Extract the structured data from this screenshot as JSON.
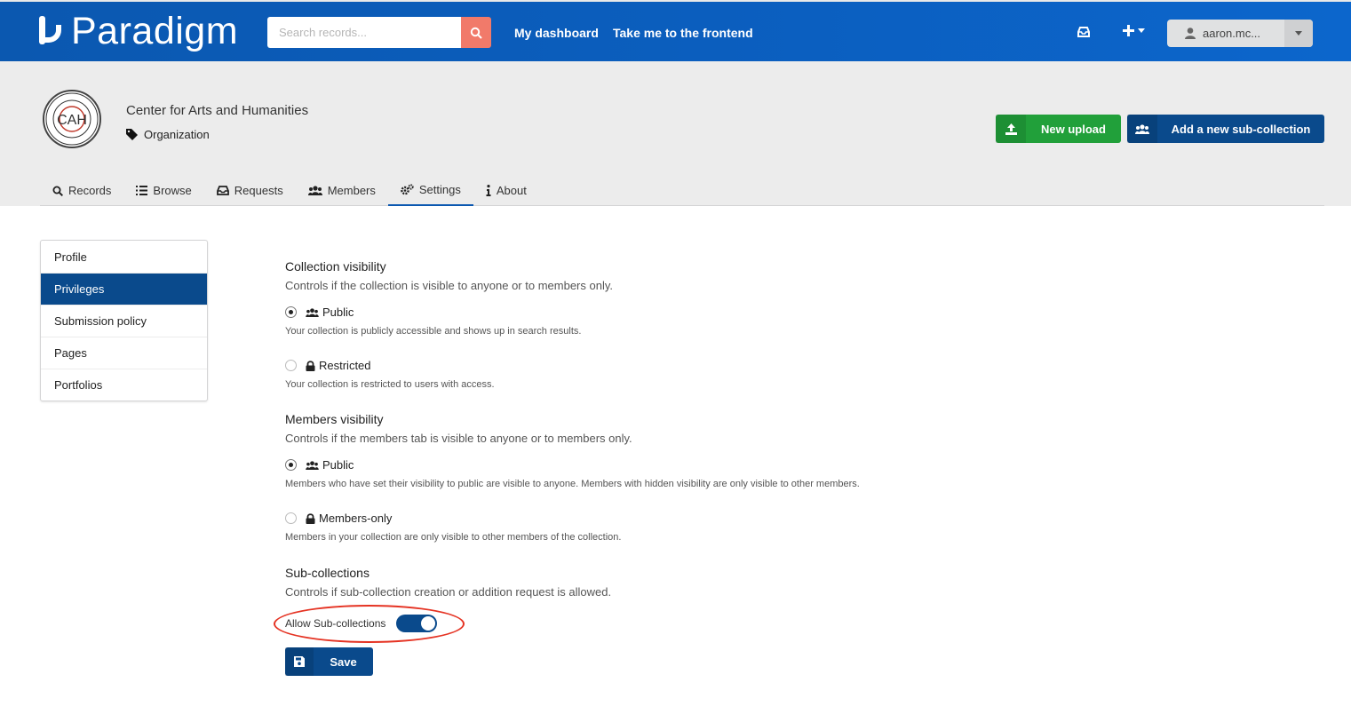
{
  "brand": {
    "name": "Paradigm"
  },
  "search": {
    "placeholder": "Search records..."
  },
  "nav": {
    "dashboard": "My dashboard",
    "frontend": "Take me to the frontend"
  },
  "user": {
    "name": "aaron.mc..."
  },
  "org": {
    "name": "Center for Arts and Humanities",
    "type": "Organization",
    "logo_text": "CAH"
  },
  "actions": {
    "new_upload": "New upload",
    "add_sub": "Add a new sub-collection"
  },
  "tabs": [
    {
      "label": "Records",
      "icon": "search-icon"
    },
    {
      "label": "Browse",
      "icon": "list-icon"
    },
    {
      "label": "Requests",
      "icon": "inbox-icon"
    },
    {
      "label": "Members",
      "icon": "users-icon"
    },
    {
      "label": "Settings",
      "icon": "cogs-icon"
    },
    {
      "label": "About",
      "icon": "info-icon"
    }
  ],
  "side_menu": [
    "Profile",
    "Privileges",
    "Submission policy",
    "Pages",
    "Portfolios"
  ],
  "collection_visibility": {
    "title": "Collection visibility",
    "desc": "Controls if the collection is visible to anyone or to members only.",
    "public_label": "Public",
    "public_help": "Your collection is publicly accessible and shows up in search results.",
    "restricted_label": "Restricted",
    "restricted_help": "Your collection is restricted to users with access.",
    "selected": "Public"
  },
  "members_visibility": {
    "title": "Members visibility",
    "desc": "Controls if the members tab is visible to anyone or to members only.",
    "public_label": "Public",
    "public_help": "Members who have set their visibility to public are visible to anyone. Members with hidden visibility are only visible to other members.",
    "members_label": "Members-only",
    "members_help": "Members in your collection are only visible to other members of the collection.",
    "selected": "Public"
  },
  "sub_collections": {
    "title": "Sub-collections",
    "desc": "Controls if sub-collection creation or addition request is allowed.",
    "toggle_label": "Allow Sub-collections",
    "enabled": true
  },
  "save_label": "Save",
  "colors": {
    "primary": "#0a4a8c",
    "success": "#21a03a",
    "search_btn": "#f17a6a",
    "highlight": "#e53323"
  }
}
